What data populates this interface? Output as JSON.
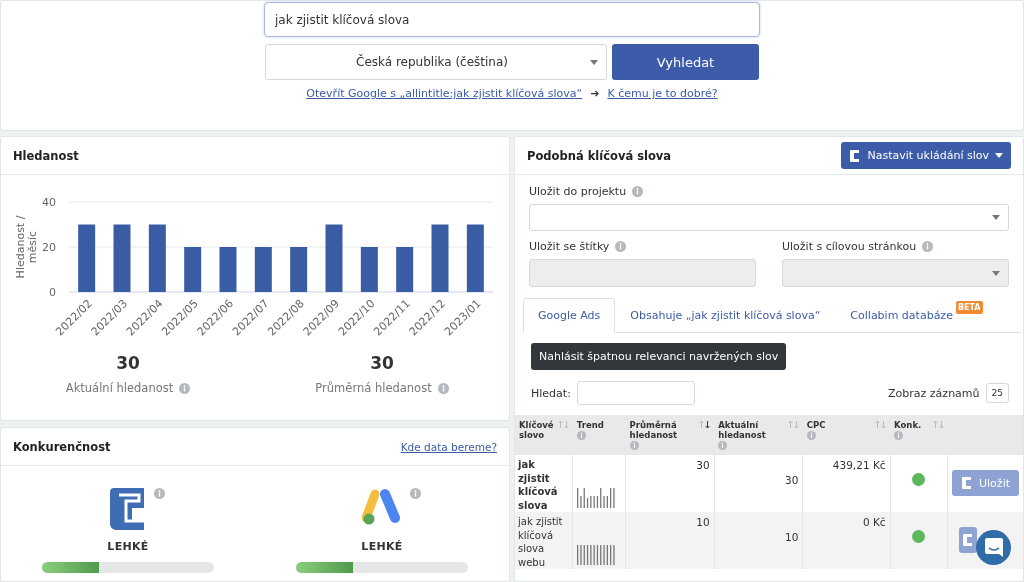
{
  "search": {
    "value": "jak zjistit klíčová slova",
    "country": "Česká republika (čeština)",
    "button": "Vyhledat",
    "google_link": "Otevřít Google s „allintitle:jak zjistit klíčová slova“",
    "arrow": "➔",
    "help_link": "K čemu je to dobré?"
  },
  "search_volume": {
    "title": "Hledanost",
    "chart_data": {
      "type": "bar",
      "ylabel": "Hledanost / měsíc",
      "categories": [
        "2022/02",
        "2022/03",
        "2022/04",
        "2022/05",
        "2022/06",
        "2022/07",
        "2022/08",
        "2022/09",
        "2022/10",
        "2022/11",
        "2022/12",
        "2023/01"
      ],
      "series": [
        {
          "color": "#3a5ca5",
          "values": [
            30,
            30,
            30,
            20,
            20,
            20,
            20,
            30,
            20,
            20,
            30,
            30
          ]
        }
      ],
      "ylim": [
        0,
        40
      ],
      "yticks": [
        0,
        20,
        40
      ]
    },
    "stats": [
      {
        "value": "30",
        "label": "Aktuální hledanost"
      },
      {
        "value": "30",
        "label": "Průměrná hledanost"
      }
    ]
  },
  "competition": {
    "title": "Konkurenčnost",
    "link": "Kde data bereme?",
    "sources": [
      {
        "kind": "collabim",
        "rating": "LEHKÉ",
        "level": 0.33
      },
      {
        "kind": "google-ads",
        "rating": "LEHKÉ",
        "level": 0.33
      }
    ]
  },
  "similar": {
    "title": "Podobná klíčová slova",
    "settings_button": "Nastavit ukládání slov",
    "project_label": "Uložit do projektu",
    "tags_label": "Uložit se štítky",
    "landing_label": "Uložit s cílovou stránkou",
    "tabs": [
      {
        "label": "Google Ads",
        "selected": true
      },
      {
        "label": "Obsahuje „jak zjistit klíčová slova“",
        "selected": false
      },
      {
        "label": "Collabim databáze",
        "selected": false,
        "badge": "BETA"
      }
    ],
    "report_button": "Nahlásit špatnou relevanci navržených slov",
    "filter_label": "Hledat:",
    "page_size_label": "Zobraz záznamů",
    "page_size": "25",
    "columns": [
      {
        "label": "Klíčové slovo",
        "info": false,
        "sorted": false
      },
      {
        "label": "Trend",
        "info": true
      },
      {
        "label": "Průměrná hledanost",
        "info": true,
        "sorted": true
      },
      {
        "label": "Aktuální hledanost",
        "info": true,
        "sorted": false
      },
      {
        "label": "CPC",
        "info": true,
        "sorted": false
      },
      {
        "label": "Konk.",
        "info": true,
        "sorted": false
      }
    ],
    "rows": [
      {
        "keyword": "jak zjistit klíčová slova",
        "highlighted": true,
        "average": "30",
        "current": "30",
        "cpc": "439,21 Kč",
        "color": "#5cb85c",
        "save": "Uložit"
      },
      {
        "keyword": "jak zjistit klíčová slova webu",
        "highlighted": false,
        "average": "10",
        "current": "10",
        "cpc": "0 Kč",
        "color": "#5cb85c"
      }
    ]
  }
}
